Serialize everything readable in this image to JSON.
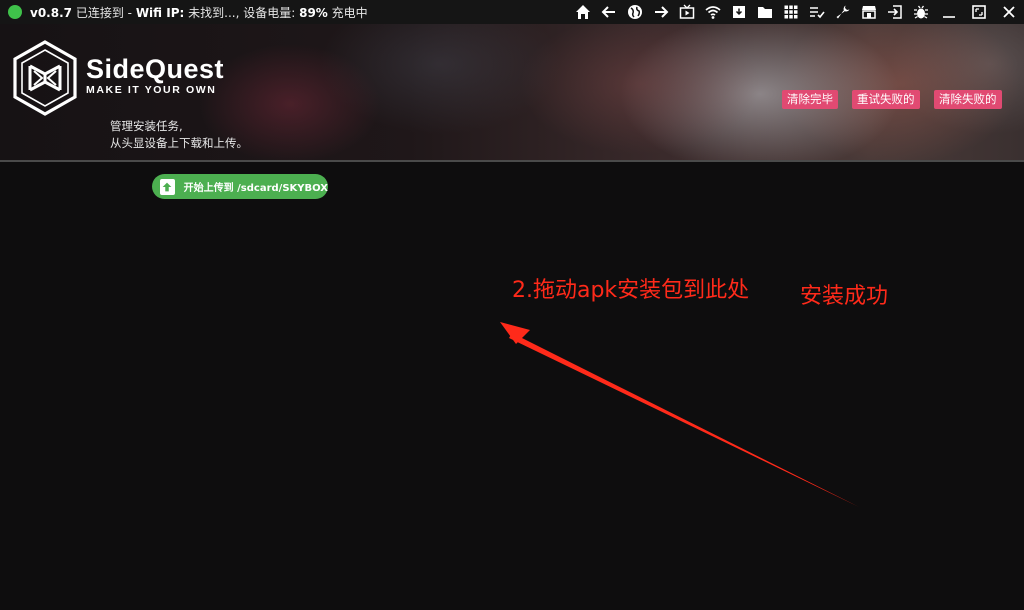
{
  "status_bar": {
    "version": "v0.8.7",
    "connection_text": "已连接到 -",
    "wifi_label": "Wifi IP:",
    "wifi_value": "未找到...,",
    "battery_label": "设备电量:",
    "battery_value": "89%",
    "charging_text": "充电中",
    "status_color": "#3fc24a"
  },
  "toolbar": {
    "icons": [
      "home-icon",
      "back-icon",
      "globe-icon",
      "forward-icon",
      "tv-icon",
      "wifi-icon",
      "package-icon",
      "folder-icon",
      "grid-icon",
      "list-check-icon",
      "wrench-icon",
      "store-icon",
      "import-icon",
      "bug-icon",
      "minimize-icon",
      "maximize-icon",
      "close-icon"
    ]
  },
  "header": {
    "brand": "SideQuest",
    "tagline": "MAKE IT YOUR OWN",
    "desc_line1": "管理安装任务,",
    "desc_line2": "从头显设备上下载和上传。",
    "buttons": {
      "clear_done": "清除完毕",
      "retry_failed": "重试失败的",
      "clear_failed": "清除失败的"
    },
    "button_color": "#e14a72"
  },
  "upload": {
    "label": "开始上传到 /sdcard/SKYBOX",
    "color": "#4caf50"
  },
  "annotations": {
    "drag_hint": "2.拖动apk安装包到此处",
    "success": "安装成功",
    "color": "#ff2a1a"
  }
}
